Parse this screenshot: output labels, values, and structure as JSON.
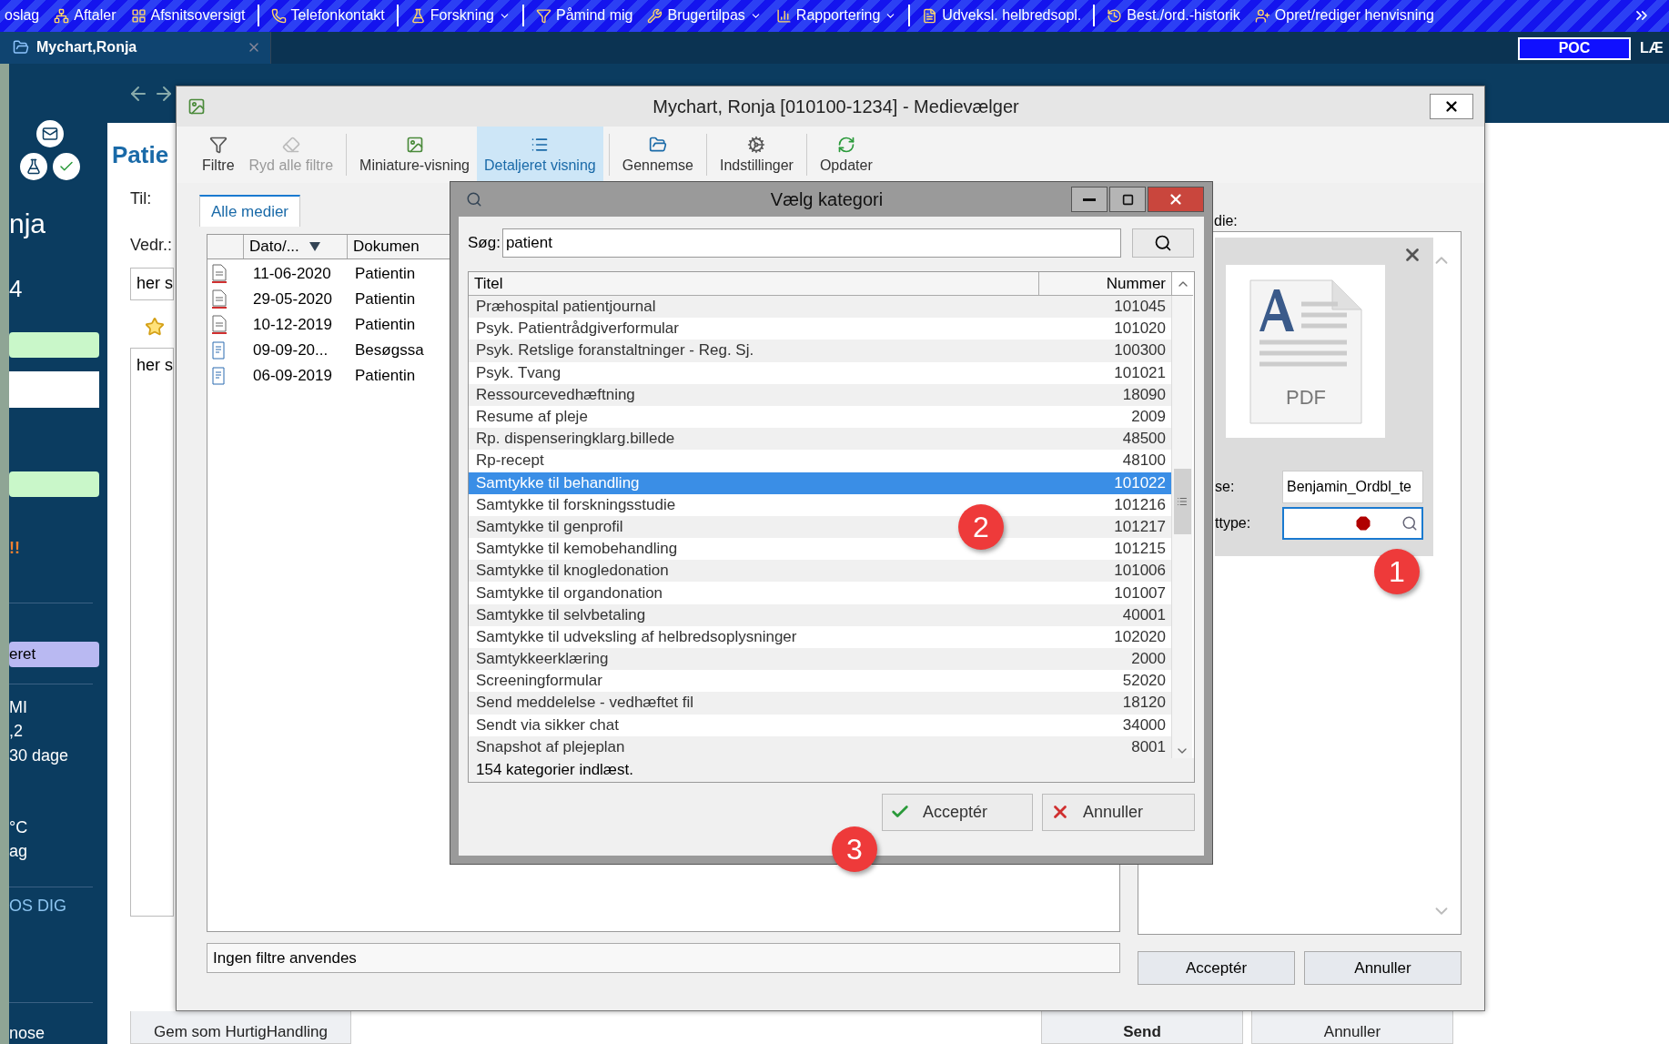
{
  "top_toolbar": {
    "items": [
      {
        "label": "oslag",
        "dropdown": false
      },
      {
        "label": "Aftaler",
        "dropdown": false
      },
      {
        "label": "Afsnitsoversigt",
        "dropdown": false
      },
      {
        "label": "Telefonkontakt",
        "dropdown": false
      },
      {
        "label": "Forskning",
        "dropdown": true
      },
      {
        "label": "Påmind mig",
        "dropdown": false
      },
      {
        "label": "Brugertilpas",
        "dropdown": true
      },
      {
        "label": "Rapportering",
        "dropdown": true
      },
      {
        "label": "Udveksl. helbredsopl.",
        "dropdown": false
      },
      {
        "label": "Best./ord.-historik",
        "dropdown": false
      },
      {
        "label": "Opret/rediger henvisning",
        "dropdown": false
      }
    ]
  },
  "tab_bar": {
    "tabs": [
      {
        "label": "Mychart,Ronja",
        "selected": true
      }
    ],
    "badge": "POC",
    "cut_label": "LÆ"
  },
  "sidebar": {
    "items": [
      {
        "kind": "icons"
      },
      {
        "kind": "name",
        "text": "nja"
      },
      {
        "kind": "number",
        "text": "4"
      },
      {
        "kind": "green_bar"
      },
      {
        "kind": "field"
      },
      {
        "kind": "green_bar"
      },
      {
        "kind": "warning",
        "text": "!!"
      },
      {
        "kind": "divider"
      },
      {
        "kind": "purple_bar",
        "text": "eret"
      },
      {
        "kind": "divider"
      },
      {
        "kind": "small",
        "text": "MI"
      },
      {
        "kind": "small",
        "text": ",2"
      },
      {
        "kind": "small",
        "text": "30 dage"
      },
      {
        "kind": "small",
        "text": "°C"
      },
      {
        "kind": "small",
        "text": "ag"
      },
      {
        "kind": "divider"
      },
      {
        "kind": "link",
        "text": "OS DIG"
      },
      {
        "kind": "divider"
      },
      {
        "kind": "small",
        "text": "nose"
      }
    ]
  },
  "patient_panel": {
    "title": "Patie",
    "to_label": "Til:",
    "re_label": "Vedr.:",
    "re_value": "her s",
    "body_value": "her s",
    "buttons": [
      {
        "label": "Gem som HurtigHandling"
      },
      {
        "label": "Send"
      },
      {
        "label": "Annuller"
      }
    ]
  },
  "media_window": {
    "title": "Mychart, Ronja [010100-1234] - Medievælger",
    "toolbar": [
      {
        "label": "Filtre",
        "selected": false,
        "disabled": false
      },
      {
        "label": "Ryd alle filtre",
        "selected": false,
        "disabled": true
      },
      {
        "label": "Miniature-visning",
        "selected": false,
        "disabled": false
      },
      {
        "label": "Detaljeret visning",
        "selected": true,
        "disabled": false
      },
      {
        "label": "Gennemse",
        "selected": false,
        "disabled": false
      },
      {
        "label": "Indstillinger",
        "selected": false,
        "disabled": false
      },
      {
        "label": "Opdater",
        "selected": false,
        "disabled": false
      }
    ],
    "tabs": [
      {
        "label": "Alle medier",
        "selected": true
      }
    ],
    "table": {
      "columns": [
        "Dato/...",
        "Dokumen"
      ],
      "rows": [
        {
          "kind": "document",
          "date": "11-06-2020",
          "doc": "Patientin"
        },
        {
          "kind": "document",
          "date": "29-05-2020",
          "doc": "Patientin"
        },
        {
          "kind": "document",
          "date": "10-12-2019",
          "doc": "Patientin"
        },
        {
          "kind": "note",
          "date": "09-09-20...",
          "doc": "Besøgssa"
        },
        {
          "kind": "note",
          "date": "06-09-2019",
          "doc": "Patientin"
        }
      ]
    },
    "footer": "Ingen filtre anvendes",
    "detail": {
      "label": "die:",
      "preview_label": "PDF",
      "fields": [
        {
          "label": "se:",
          "value": "Benjamin_Ordbl_te",
          "error": false,
          "focused": false
        },
        {
          "label": "ttype:",
          "error": true,
          "focused": true
        }
      ]
    },
    "buttons": [
      {
        "label": "Acceptér"
      },
      {
        "label": "Annuller"
      }
    ]
  },
  "category_dialog": {
    "title": "Vælg kategori",
    "search": {
      "label": "Søg:",
      "value": "patient"
    },
    "columns": [
      "Titel",
      "Nummer"
    ],
    "rows": [
      {
        "title": "Præhospital patientjournal",
        "number": "101045",
        "selected": false
      },
      {
        "title": "Psyk. Patientrådgiverformular",
        "number": "101020",
        "selected": false
      },
      {
        "title": "Psyk. Retslige foranstaltninger - Reg. Sj.",
        "number": "100300",
        "selected": false
      },
      {
        "title": "Psyk. Tvang",
        "number": "101021",
        "selected": false
      },
      {
        "title": "Ressourcevedhæftning",
        "number": "18090",
        "selected": false
      },
      {
        "title": "Resume af pleje",
        "number": "2009",
        "selected": false
      },
      {
        "title": "Rp. dispenseringklarg.billede",
        "number": "48500",
        "selected": false
      },
      {
        "title": "Rp-recept",
        "number": "48100",
        "selected": false
      },
      {
        "title": "Samtykke til behandling",
        "number": "101022",
        "selected": true
      },
      {
        "title": "Samtykke til forskningsstudie",
        "number": "101216",
        "selected": false
      },
      {
        "title": "Samtykke til genprofil",
        "number": "101217",
        "selected": false
      },
      {
        "title": "Samtykke til kemobehandling",
        "number": "101215",
        "selected": false
      },
      {
        "title": "Samtykke til knogledonation",
        "number": "101006",
        "selected": false
      },
      {
        "title": "Samtykke til organdonation",
        "number": "101007",
        "selected": false
      },
      {
        "title": "Samtykke til selvbetaling",
        "number": "40001",
        "selected": false
      },
      {
        "title": "Samtykke til udveksling af helbredsoplysninger",
        "number": "102020",
        "selected": false
      },
      {
        "title": "Samtykkeerklæring",
        "number": "2000",
        "selected": false
      },
      {
        "title": "Screeningformular",
        "number": "52020",
        "selected": false
      },
      {
        "title": "Send meddelelse - vedhæftet fil",
        "number": "18120",
        "selected": false
      },
      {
        "title": "Sendt via sikker chat",
        "number": "34000",
        "selected": false
      },
      {
        "title": "Snapshot af plejeplan",
        "number": "8001",
        "selected": false
      }
    ],
    "status": "154 kategorier indlæst.",
    "buttons": [
      {
        "label": "Acceptér",
        "kind": "accept"
      },
      {
        "label": "Annuller",
        "kind": "cancel"
      }
    ]
  },
  "callouts": [
    {
      "label": "1"
    },
    {
      "label": "2"
    },
    {
      "label": "3"
    }
  ]
}
